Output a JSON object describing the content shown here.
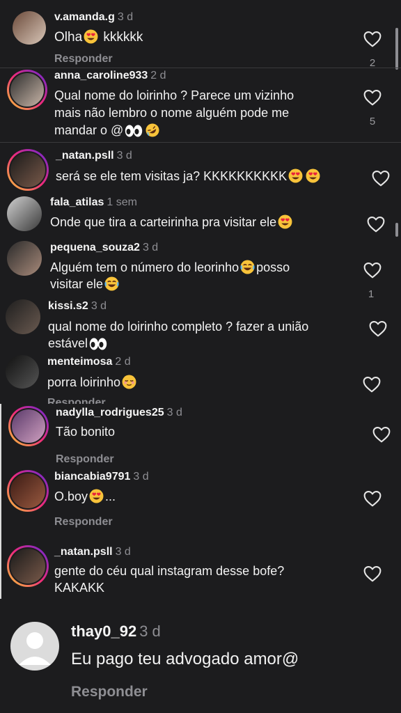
{
  "colors": {
    "background": "#1c1c1e",
    "text": "#f2f2f2",
    "muted": "#8e8e93",
    "ring_gradient": [
      "#f9ce34",
      "#ee2a7b",
      "#6228d7"
    ]
  },
  "comments": [
    {
      "username": "v.amanda.g",
      "time": "3 d",
      "text": "Olha",
      "text_after": "kkkkkk",
      "reply": "Responder",
      "likes": "2"
    },
    {
      "username": "anna_caroline933",
      "time": "2 d",
      "text_line1": "Qual nome do loirinho ? Parece um vizinho",
      "text_line2": "mais não lembro o nome alguém pode me",
      "text_line3": "mandar o @",
      "likes": "5"
    },
    {
      "username": "_natan.psll",
      "time": "3 d",
      "text": "será se ele tem visitas ja? KKKKKKKKKK"
    },
    {
      "username": "fala_atilas",
      "time": "1 sem",
      "text": "Onde que tira a carteirinha pra visitar ele"
    },
    {
      "username": "pequena_souza2",
      "time": "3 d",
      "text_line1": "Alguém tem o número do leorinho",
      "text_after": "posso",
      "text_line2": "visitar ele",
      "likes": "1"
    },
    {
      "username": "kissi.s2",
      "time": "3 d",
      "text_line1": "qual nome do loirinho completo ? fazer a união",
      "text_line2": "estável"
    },
    {
      "username": "menteimosa",
      "time": "2 d",
      "text": "porra loirinho",
      "reply": "Responder"
    },
    {
      "username": "nadylla_rodrigues25",
      "time": "3 d",
      "text": "Tão bonito",
      "reply": "Responder"
    },
    {
      "username": "biancabia9791",
      "time": "3 d",
      "text": "O.boy",
      "text_after": "...",
      "reply": "Responder"
    },
    {
      "username": "_natan.psll",
      "time": "3 d",
      "text_line1": "gente do céu qual instagram desse bofe?",
      "text_line2": "KAKAKK"
    },
    {
      "username": "thay0_92",
      "time": "3 d",
      "text": "Eu pago teu advogado amor@",
      "reply": "Responder"
    }
  ]
}
